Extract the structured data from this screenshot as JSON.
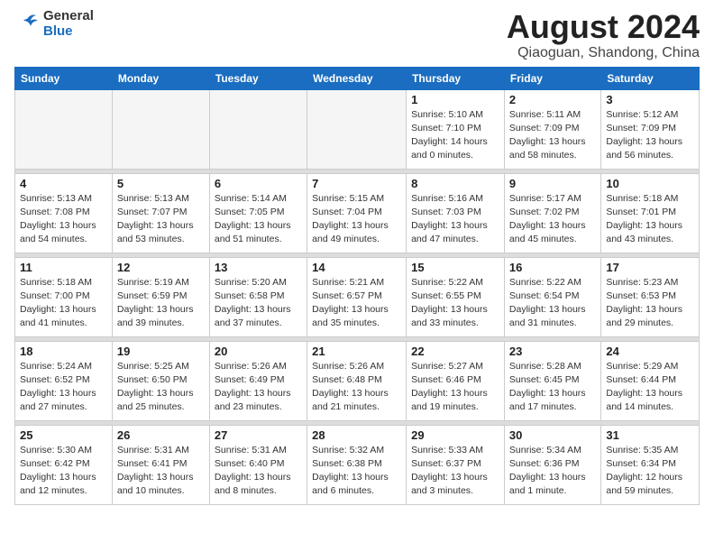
{
  "header": {
    "logo_line1": "General",
    "logo_line2": "Blue",
    "month_year": "August 2024",
    "location": "Qiaoguan, Shandong, China"
  },
  "weekdays": [
    "Sunday",
    "Monday",
    "Tuesday",
    "Wednesday",
    "Thursday",
    "Friday",
    "Saturday"
  ],
  "weeks": [
    {
      "days": [
        {
          "num": "",
          "empty": true
        },
        {
          "num": "",
          "empty": true
        },
        {
          "num": "",
          "empty": true
        },
        {
          "num": "",
          "empty": true
        },
        {
          "num": "1",
          "sunrise": "5:10 AM",
          "sunset": "7:10 PM",
          "daylight": "14 hours and 0 minutes."
        },
        {
          "num": "2",
          "sunrise": "5:11 AM",
          "sunset": "7:09 PM",
          "daylight": "13 hours and 58 minutes."
        },
        {
          "num": "3",
          "sunrise": "5:12 AM",
          "sunset": "7:09 PM",
          "daylight": "13 hours and 56 minutes."
        }
      ]
    },
    {
      "days": [
        {
          "num": "4",
          "sunrise": "5:13 AM",
          "sunset": "7:08 PM",
          "daylight": "13 hours and 54 minutes."
        },
        {
          "num": "5",
          "sunrise": "5:13 AM",
          "sunset": "7:07 PM",
          "daylight": "13 hours and 53 minutes."
        },
        {
          "num": "6",
          "sunrise": "5:14 AM",
          "sunset": "7:05 PM",
          "daylight": "13 hours and 51 minutes."
        },
        {
          "num": "7",
          "sunrise": "5:15 AM",
          "sunset": "7:04 PM",
          "daylight": "13 hours and 49 minutes."
        },
        {
          "num": "8",
          "sunrise": "5:16 AM",
          "sunset": "7:03 PM",
          "daylight": "13 hours and 47 minutes."
        },
        {
          "num": "9",
          "sunrise": "5:17 AM",
          "sunset": "7:02 PM",
          "daylight": "13 hours and 45 minutes."
        },
        {
          "num": "10",
          "sunrise": "5:18 AM",
          "sunset": "7:01 PM",
          "daylight": "13 hours and 43 minutes."
        }
      ]
    },
    {
      "days": [
        {
          "num": "11",
          "sunrise": "5:18 AM",
          "sunset": "7:00 PM",
          "daylight": "13 hours and 41 minutes."
        },
        {
          "num": "12",
          "sunrise": "5:19 AM",
          "sunset": "6:59 PM",
          "daylight": "13 hours and 39 minutes."
        },
        {
          "num": "13",
          "sunrise": "5:20 AM",
          "sunset": "6:58 PM",
          "daylight": "13 hours and 37 minutes."
        },
        {
          "num": "14",
          "sunrise": "5:21 AM",
          "sunset": "6:57 PM",
          "daylight": "13 hours and 35 minutes."
        },
        {
          "num": "15",
          "sunrise": "5:22 AM",
          "sunset": "6:55 PM",
          "daylight": "13 hours and 33 minutes."
        },
        {
          "num": "16",
          "sunrise": "5:22 AM",
          "sunset": "6:54 PM",
          "daylight": "13 hours and 31 minutes."
        },
        {
          "num": "17",
          "sunrise": "5:23 AM",
          "sunset": "6:53 PM",
          "daylight": "13 hours and 29 minutes."
        }
      ]
    },
    {
      "days": [
        {
          "num": "18",
          "sunrise": "5:24 AM",
          "sunset": "6:52 PM",
          "daylight": "13 hours and 27 minutes."
        },
        {
          "num": "19",
          "sunrise": "5:25 AM",
          "sunset": "6:50 PM",
          "daylight": "13 hours and 25 minutes."
        },
        {
          "num": "20",
          "sunrise": "5:26 AM",
          "sunset": "6:49 PM",
          "daylight": "13 hours and 23 minutes."
        },
        {
          "num": "21",
          "sunrise": "5:26 AM",
          "sunset": "6:48 PM",
          "daylight": "13 hours and 21 minutes."
        },
        {
          "num": "22",
          "sunrise": "5:27 AM",
          "sunset": "6:46 PM",
          "daylight": "13 hours and 19 minutes."
        },
        {
          "num": "23",
          "sunrise": "5:28 AM",
          "sunset": "6:45 PM",
          "daylight": "13 hours and 17 minutes."
        },
        {
          "num": "24",
          "sunrise": "5:29 AM",
          "sunset": "6:44 PM",
          "daylight": "13 hours and 14 minutes."
        }
      ]
    },
    {
      "days": [
        {
          "num": "25",
          "sunrise": "5:30 AM",
          "sunset": "6:42 PM",
          "daylight": "13 hours and 12 minutes."
        },
        {
          "num": "26",
          "sunrise": "5:31 AM",
          "sunset": "6:41 PM",
          "daylight": "13 hours and 10 minutes."
        },
        {
          "num": "27",
          "sunrise": "5:31 AM",
          "sunset": "6:40 PM",
          "daylight": "13 hours and 8 minutes."
        },
        {
          "num": "28",
          "sunrise": "5:32 AM",
          "sunset": "6:38 PM",
          "daylight": "13 hours and 6 minutes."
        },
        {
          "num": "29",
          "sunrise": "5:33 AM",
          "sunset": "6:37 PM",
          "daylight": "13 hours and 3 minutes."
        },
        {
          "num": "30",
          "sunrise": "5:34 AM",
          "sunset": "6:36 PM",
          "daylight": "13 hours and 1 minute."
        },
        {
          "num": "31",
          "sunrise": "5:35 AM",
          "sunset": "6:34 PM",
          "daylight": "12 hours and 59 minutes."
        }
      ]
    }
  ]
}
